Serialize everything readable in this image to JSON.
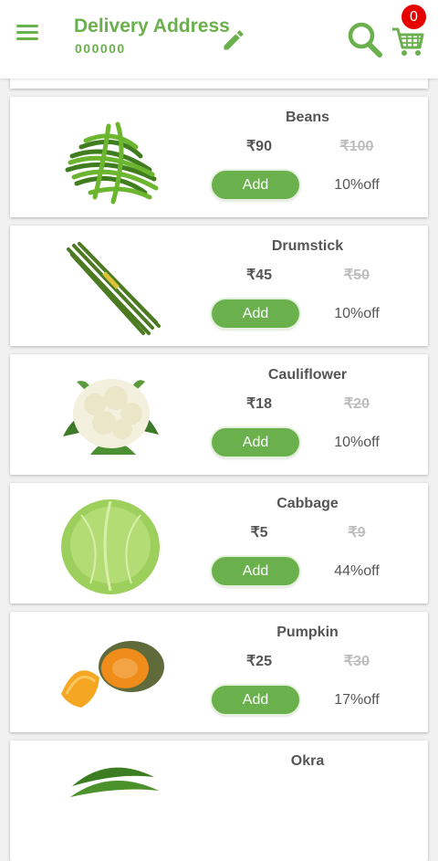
{
  "header": {
    "title": "Delivery Address",
    "pincode": "000000",
    "cart_count": "0",
    "icons": [
      "menu-icon",
      "edit-icon",
      "search-icon",
      "cart-icon"
    ]
  },
  "colors": {
    "accent": "#6ab04c",
    "badge": "#e60000",
    "muted": "#bdbdbd",
    "text": "#555555"
  },
  "products": [
    {
      "name": "Beans",
      "price": "₹90",
      "mrp": "₹100",
      "button": "Add",
      "discount": "10%off",
      "image": "green-beans"
    },
    {
      "name": "Drumstick",
      "price": "₹45",
      "mrp": "₹50",
      "button": "Add",
      "discount": "10%off",
      "image": "drumstick"
    },
    {
      "name": "Cauliflower",
      "price": "₹18",
      "mrp": "₹20",
      "button": "Add",
      "discount": "10%off",
      "image": "cauliflower"
    },
    {
      "name": "Cabbage",
      "price": "₹5",
      "mrp": "₹9",
      "button": "Add",
      "discount": "44%off",
      "image": "cabbage"
    },
    {
      "name": "Pumpkin",
      "price": "₹25",
      "mrp": "₹30",
      "button": "Add",
      "discount": "17%off",
      "image": "pumpkin"
    },
    {
      "name": "Okra",
      "price": "",
      "mrp": "",
      "button": "",
      "discount": "",
      "image": "okra"
    }
  ]
}
